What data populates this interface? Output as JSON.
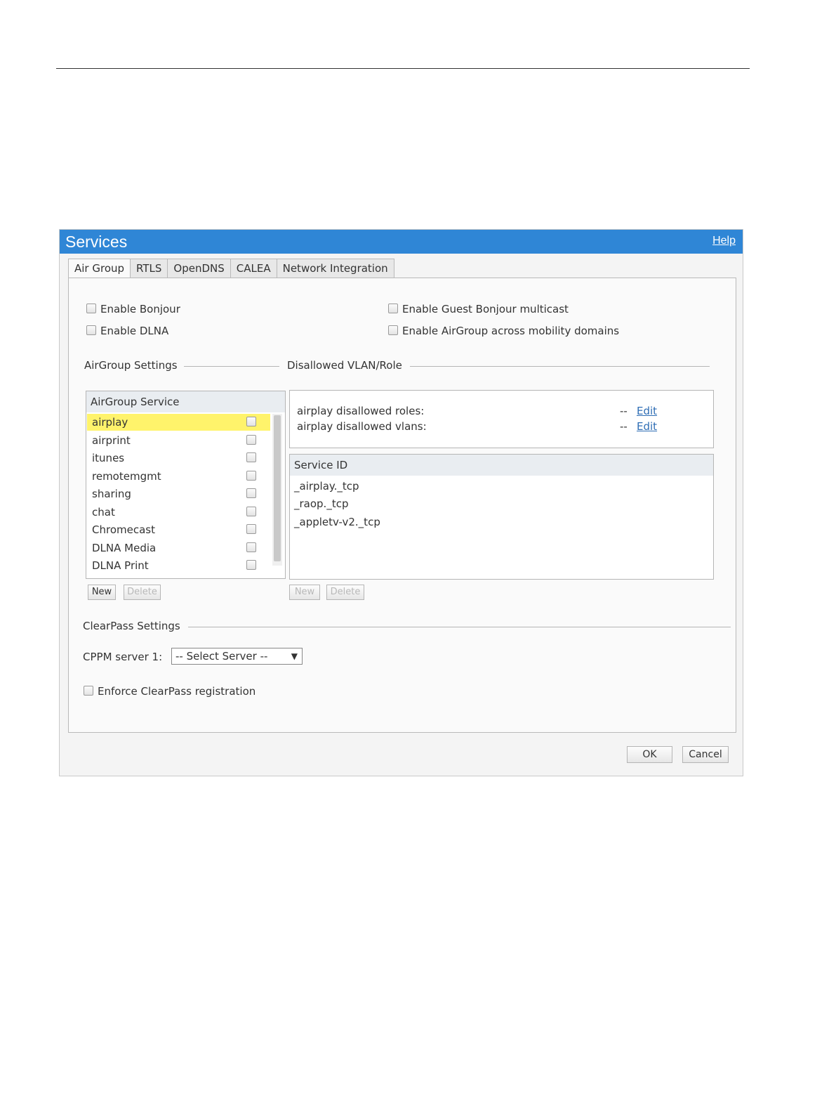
{
  "dialog": {
    "title": "Services",
    "help": "Help"
  },
  "tabs": [
    "Air Group",
    "RTLS",
    "OpenDNS",
    "CALEA",
    "Network Integration"
  ],
  "options": {
    "enable_bonjour": "Enable Bonjour",
    "enable_dlna": "Enable DLNA",
    "enable_guest_bonjour": "Enable Guest Bonjour multicast",
    "enable_across_domains": "Enable AirGroup across mobility domains"
  },
  "airgroup_settings": {
    "label": "AirGroup Settings",
    "header": "AirGroup Service",
    "services": [
      "airplay",
      "airprint",
      "itunes",
      "remotemgmt",
      "sharing",
      "chat",
      "Chromecast",
      "DLNA Media",
      "DLNA Print"
    ],
    "selected": "airplay",
    "new_label": "New",
    "delete_label": "Delete"
  },
  "disallowed": {
    "label": "Disallowed VLAN/Role",
    "roles_label": "airplay disallowed roles:",
    "vlans_label": "airplay disallowed vlans:",
    "roles_value": "--",
    "vlans_value": "--",
    "edit_label": "Edit"
  },
  "service_id": {
    "header": "Service ID",
    "ids": [
      "_airplay._tcp",
      "_raop._tcp",
      "_appletv-v2._tcp"
    ],
    "new_label": "New",
    "delete_label": "Delete"
  },
  "clearpass": {
    "label": "ClearPass Settings",
    "cppm_label": "CPPM server 1:",
    "select_value": "-- Select Server --",
    "enforce_label": "Enforce ClearPass registration"
  },
  "footer": {
    "ok": "OK",
    "cancel": "Cancel"
  }
}
